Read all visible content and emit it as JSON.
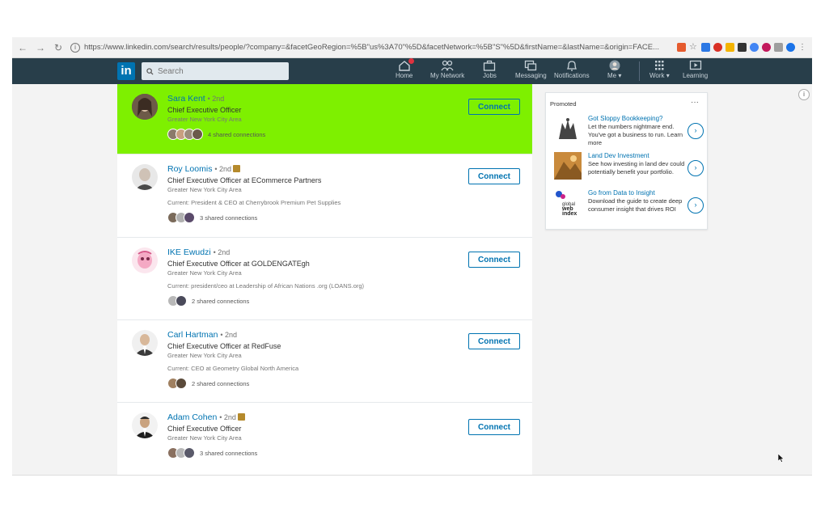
{
  "browser": {
    "url": "https://www.linkedin.com/search/results/people/?company=&facetGeoRegion=%5B\"us%3A70\"%5D&facetNetwork=%5B\"S\"%5D&firstName=&lastName=&origin=FACE..."
  },
  "nav": {
    "search_placeholder": "Search",
    "items": [
      {
        "label": "Home",
        "icon": "home-icon"
      },
      {
        "label": "My Network",
        "icon": "network-icon"
      },
      {
        "label": "Jobs",
        "icon": "briefcase-icon"
      },
      {
        "label": "Messaging",
        "icon": "messaging-icon"
      },
      {
        "label": "Notifications",
        "icon": "bell-icon"
      },
      {
        "label": "Me ▾",
        "icon": "avatar"
      },
      {
        "label": "Work ▾",
        "icon": "grid-icon"
      },
      {
        "label": "Learning",
        "icon": "play-icon"
      }
    ]
  },
  "results": [
    {
      "name": "Sara Kent",
      "degree": "• 2nd",
      "title": "Chief Executive Officer",
      "location": "Greater New York City Area",
      "current": "",
      "shared": "4 shared connections",
      "connect": "Connect",
      "highlighted": true
    },
    {
      "name": "Roy Loomis",
      "degree": "• 2nd",
      "title": "Chief Executive Officer at ECommerce Partners",
      "location": "Greater New York City Area",
      "current": "Current: President & CEO at Cherrybrook Premium Pet Supplies",
      "shared": "3 shared connections",
      "connect": "Connect",
      "highlighted": false
    },
    {
      "name": "IKE Ewudzi",
      "degree": "• 2nd",
      "title": "Chief Executive Officer at GOLDENGATEgh",
      "location": "Greater New York City Area",
      "current": "Current: president/ceo at Leadership of African Nations .org (LOANS.org)",
      "shared": "2 shared connections",
      "connect": "Connect",
      "highlighted": false
    },
    {
      "name": "Carl Hartman",
      "degree": "• 2nd",
      "title": "Chief Executive Officer at RedFuse",
      "location": "Greater New York City Area",
      "current": "Current: CEO at Geometry Global North America",
      "shared": "2 shared connections",
      "connect": "Connect",
      "highlighted": false
    },
    {
      "name": "Adam Cohen",
      "degree": "• 2nd",
      "title": "Chief Executive Officer",
      "location": "Greater New York City Area",
      "current": "",
      "shared": "3 shared connections",
      "connect": "Connect",
      "highlighted": false
    }
  ],
  "promoted": {
    "heading": "Promoted",
    "more": "···",
    "ads": [
      {
        "title": "Got Sloppy Bookkeeping?",
        "text": "Let the numbers nightmare end. You've got a business to run. Learn more"
      },
      {
        "title": "Land Dev Investment",
        "text": "See how investing in land dev could potentially benefit your portfolio."
      },
      {
        "title": "Go from Data to Insight",
        "text": "Download the guide to create deep consumer insight that drives ROI"
      }
    ]
  },
  "colors": {
    "highlight": "#7ef000",
    "nav_bg": "#283e4a",
    "link": "#0073b1"
  }
}
